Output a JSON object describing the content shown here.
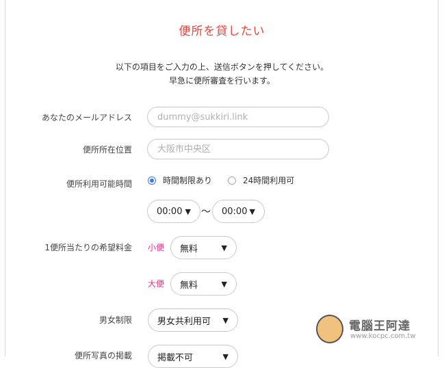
{
  "page": {
    "title": "便所を貸したい",
    "intro_line1": "以下の項目をご入力の上、送信ボタンを押してください。",
    "intro_line2": "早急に便所審査を行います。"
  },
  "form": {
    "email": {
      "label": "あなたのメールアドレス",
      "placeholder": "dummy@sukkiri.link"
    },
    "location": {
      "label": "便所所在位置",
      "placeholder": "大阪市中央区"
    },
    "availability": {
      "label": "便所利用可能時間",
      "options": [
        "時間制限あり",
        "24時間利用可"
      ],
      "selected_index": 0,
      "from": "00:00",
      "to": "00:00",
      "separator": "〜"
    },
    "fee": {
      "label": "1便所当たりの希望料金",
      "small_label": "小便",
      "small_value": "無料",
      "large_label": "大便",
      "large_value": "無料"
    },
    "gender": {
      "label": "男女制限",
      "value": "男女共利用可"
    },
    "photo": {
      "label": "便所写真の掲載",
      "value": "掲載不可"
    }
  },
  "caret": "▼",
  "watermark": {
    "text": "電腦王阿達",
    "url": "www.kocpc.com.tw"
  }
}
